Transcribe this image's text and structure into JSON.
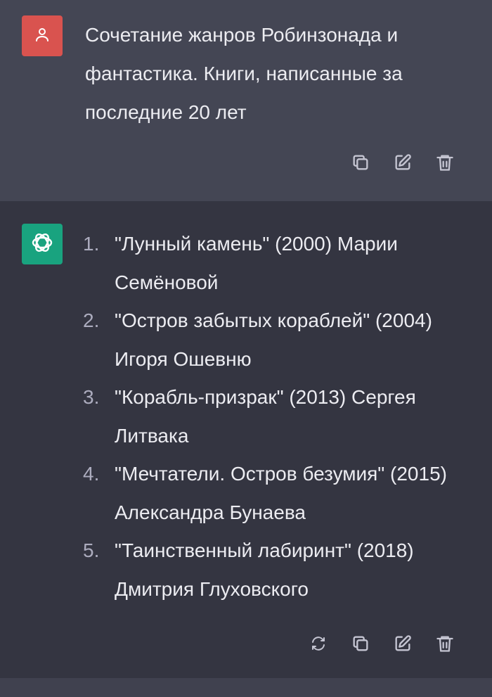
{
  "user_message": {
    "avatar_icon": "person-icon",
    "avatar_color": "#d9534f",
    "text": "Сочетание жанров Робинзонада и фантастика. Книги, написанные за последние 20 лет",
    "actions": [
      "copy-icon",
      "edit-icon",
      "trash-icon"
    ]
  },
  "assistant_message": {
    "avatar_icon": "openai-logo-icon",
    "avatar_color": "#19a37f",
    "items": [
      {
        "num": "1.",
        "text": "\"Лунный камень\" (2000) Марии Семёновой"
      },
      {
        "num": "2.",
        "text": "\"Остров забытых кораблей\" (2004) Игоря Ошевню"
      },
      {
        "num": "3.",
        "text": "\"Корабль-призрак\" (2013) Сергея Литвака"
      },
      {
        "num": "4.",
        "text": "\"Мечтатели. Остров безумия\" (2015) Александра Бунаева"
      },
      {
        "num": "5.",
        "text": "\"Таинственный лабиринт\" (2018) Дмитрия Глуховского"
      }
    ],
    "actions": [
      "regenerate-icon",
      "copy-icon",
      "edit-icon",
      "trash-icon"
    ]
  }
}
